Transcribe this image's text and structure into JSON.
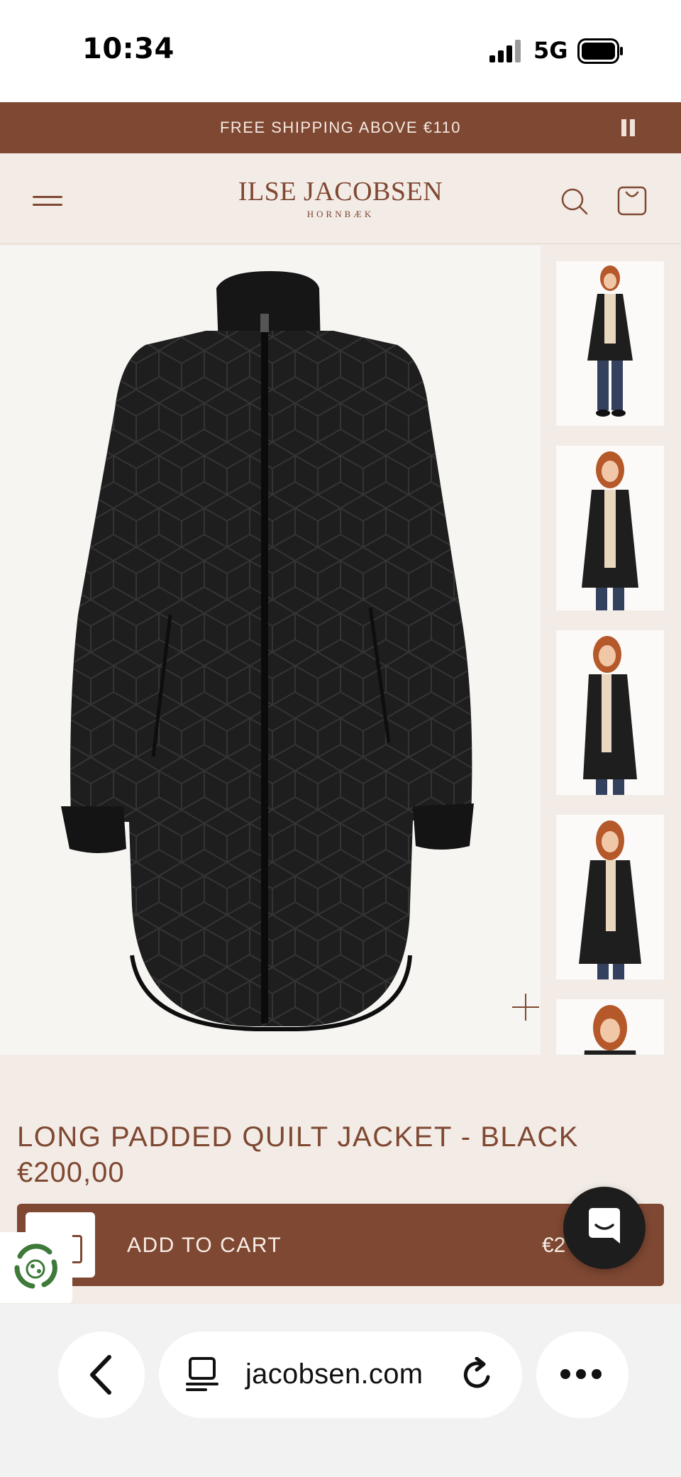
{
  "status_bar": {
    "time": "10:34",
    "network": "5G",
    "signal_bars": 4,
    "signal_icon": "signal-icon",
    "battery_icon": "battery-icon"
  },
  "promo": {
    "text": "FREE SHIPPING ABOVE €110",
    "pause_icon": "pause-icon"
  },
  "header": {
    "menu_icon": "hamburger-menu-icon",
    "brand": "ILSE JACOBSEN",
    "brand_sub": "HORNBÆK",
    "search_icon": "search-icon",
    "cart_icon": "shopping-bag-icon"
  },
  "gallery": {
    "main_alt": "Black long padded quilt jacket",
    "zoom_icon": "plus-zoom-icon",
    "thumbnails": [
      "Model front full length",
      "Model front three-quarter",
      "Model three-quarter angle",
      "Model front detail",
      "Model close-up"
    ]
  },
  "product": {
    "title": "LONG PADDED QUILT JACKET - BLACK",
    "price": "€200,00"
  },
  "cart_bar": {
    "label": "ADD TO CART",
    "price": "€2",
    "thumb_icon": "product-thumb-icon"
  },
  "eco_badge": {
    "icon": "recycle-eco-icon"
  },
  "chat": {
    "icon": "chat-bubble-icon"
  },
  "browser": {
    "url": "jacobsen.com",
    "back_icon": "back-chevron-icon",
    "reader_icon": "reader-tabs-icon",
    "reload_icon": "reload-icon",
    "more_icon": "more-dots-icon"
  },
  "colors": {
    "brand_brown": "#7f4832",
    "background": "#f3ece6",
    "jacket": "#1e1e1e",
    "skin": "#f0c8a8",
    "hair": "#b5582a"
  }
}
